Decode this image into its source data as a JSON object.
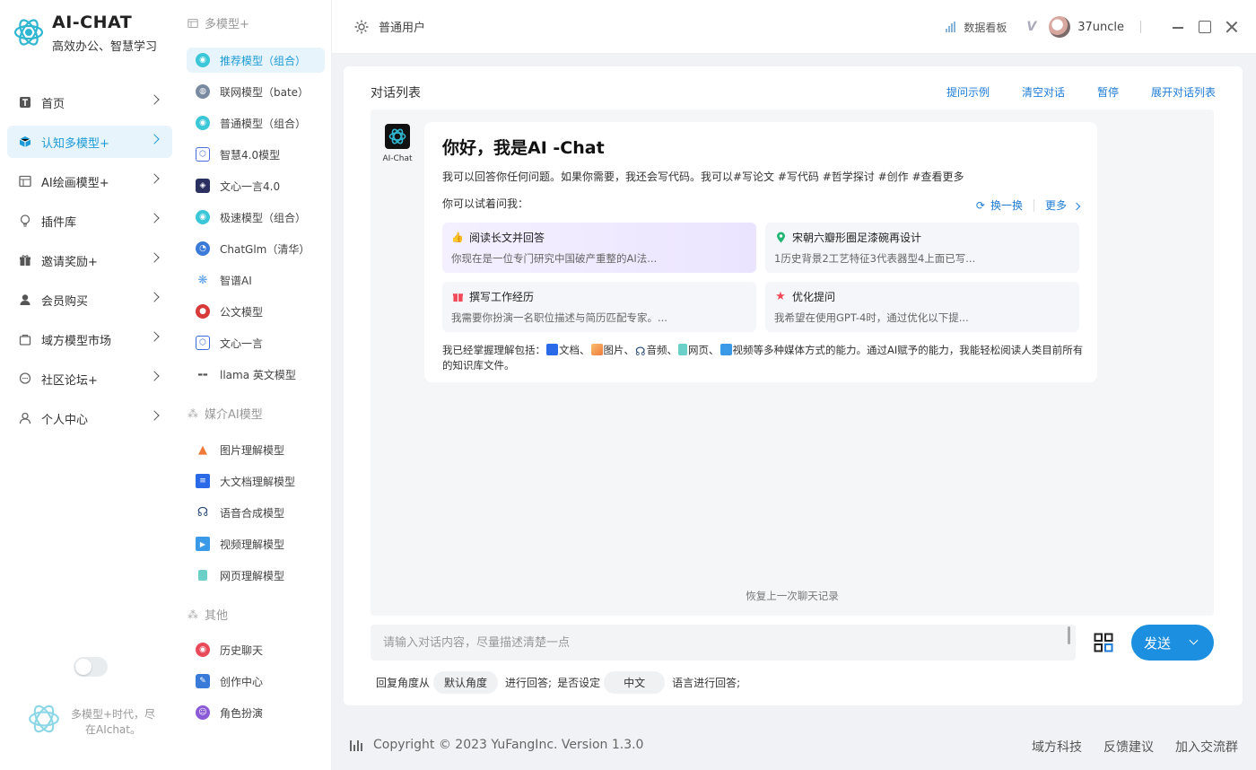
{
  "app": {
    "title": "AI-CHAT",
    "subtitle": "高效办公、智慧学习"
  },
  "nav": [
    {
      "id": "home",
      "label": "首页",
      "icon": "text-t-icon"
    },
    {
      "id": "cognitive",
      "label": "认知多模型+",
      "icon": "cube-icon",
      "active": true
    },
    {
      "id": "paint",
      "label": "AI绘画模型+",
      "icon": "image-frame-icon"
    },
    {
      "id": "plugins",
      "label": "插件库",
      "icon": "bulb-icon"
    },
    {
      "id": "invite",
      "label": "邀请奖励+",
      "icon": "gift-icon"
    },
    {
      "id": "member",
      "label": "会员购买",
      "icon": "user-icon"
    },
    {
      "id": "market",
      "label": "域方模型市场",
      "icon": "bag-icon"
    },
    {
      "id": "forum",
      "label": "社区论坛+",
      "icon": "chat-bubble-icon"
    },
    {
      "id": "personal",
      "label": "个人中心",
      "icon": "user-outline-icon"
    }
  ],
  "bottom_text": "多模型+时代，尽在AIchat。",
  "models": {
    "section1": "多模型+",
    "items1": [
      {
        "label": "推荐模型（组合）",
        "active": true,
        "color": "#3cc7d8"
      },
      {
        "label": "联网模型（bate）",
        "color": "#7a8aa0"
      },
      {
        "label": "普通模型（组合）",
        "color": "#3cc7d8"
      },
      {
        "label": "智慧4.0模型",
        "color": "#4a6cd8"
      },
      {
        "label": "文心一言4.0",
        "color": "#2a3060"
      },
      {
        "label": "极速模型（组合）",
        "color": "#3cc7d8"
      },
      {
        "label": "ChatGlm（清华）",
        "color": "#3a7ad8"
      },
      {
        "label": "智谱AI",
        "color": "#5aa0e8"
      },
      {
        "label": "公文模型",
        "color": "#d83a3a"
      },
      {
        "label": "文心一言",
        "color": "#3a6ad8"
      },
      {
        "label": "llama 英文模型",
        "color": "#555555"
      }
    ],
    "section2": "媒介AI模型",
    "items2": [
      {
        "label": "图片理解模型",
        "color": "#f07a3a"
      },
      {
        "label": "大文档理解模型",
        "color": "#2a6ae8"
      },
      {
        "label": "语音合成模型",
        "color": "#2a4a7a"
      },
      {
        "label": "视频理解模型",
        "color": "#3a9ae8"
      },
      {
        "label": "网页理解模型",
        "color": "#6ad0c8"
      }
    ],
    "section3": "其他",
    "items3": [
      {
        "label": "历史聊天",
        "color": "#e84a5a"
      },
      {
        "label": "创作中心",
        "color": "#3a7ad8"
      },
      {
        "label": "角色扮演",
        "color": "#8a5ad8"
      }
    ]
  },
  "header": {
    "user_type": "普通用户",
    "dashboard": "数据看板",
    "vip": "V",
    "username": "37uncle"
  },
  "main": {
    "title": "对话列表",
    "links": [
      "提问示例",
      "清空对话",
      "暂停",
      "展开对话列表"
    ],
    "bot_name": "AI-Chat",
    "greeting": "你好，我是AI -Chat",
    "intro": "我可以回答你任何问题。如果你需要，我还会写代码。我可以#写论文 #写代码 #哲学探讨 #创作 #查看更多",
    "try_label": "你可以试着问我：",
    "refresh": "换一换",
    "more": "更多",
    "suggestions": [
      {
        "title": "阅读长文并回答",
        "desc": "你现在是一位专门研究中国破产重整的AI法...",
        "icon": "thumb-icon",
        "highlight": true
      },
      {
        "title": "宋朝六瓣形圈足漆碗再设计",
        "desc": "1历史背景2工艺特征3代表器型4上面已写...",
        "icon": "location-pin-icon"
      },
      {
        "title": "撰写工作经历",
        "desc": "我需要你扮演一名职位描述与简历匹配专家。...",
        "icon": "gift-icon"
      },
      {
        "title": "优化提问",
        "desc": "我希望在使用GPT-4时，通过优化以下提...",
        "icon": "star-icon"
      }
    ],
    "caps": {
      "prefix": "我已经掌握理解包括：",
      "doc": "文档、",
      "img": "图片、",
      "audio": "音频、",
      "web": "网页、",
      "video": "视频",
      "suffix": "等多种媒体方式的能力。通过AI赋予的能力，我能轻松阅读人类目前所有的知识库文件。"
    },
    "restore": "恢复上一次聊天记录",
    "input_placeholder": "请输入对话内容，尽量描述清楚一点",
    "send": "发送",
    "opts": {
      "p1": "回复角度从",
      "angle": "默认角度",
      "p2": "进行回答;",
      "p3": "是否设定",
      "lang": "中文",
      "p4": "语言进行回答;"
    }
  },
  "footer": {
    "copyright": "Copyright © 2023 YuFangInc. Version 1.3.0",
    "links": [
      "域方科技",
      "反馈建议",
      "加入交流群"
    ]
  }
}
